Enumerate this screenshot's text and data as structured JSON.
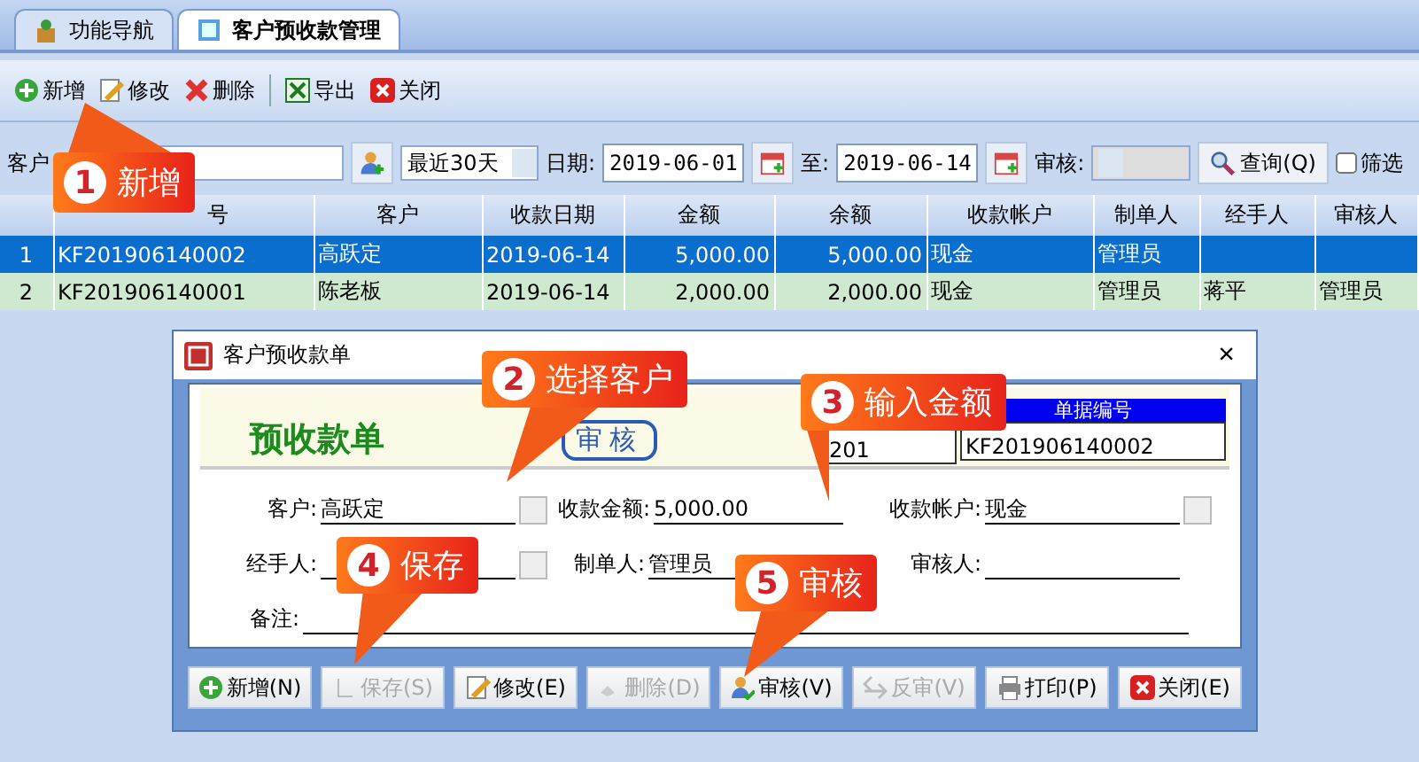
{
  "tabs": [
    {
      "label": "功能导航",
      "selected": false
    },
    {
      "label": "客户预收款管理",
      "selected": true
    }
  ],
  "toolbar": [
    {
      "label": "新增"
    },
    {
      "label": "修改"
    },
    {
      "label": "删除"
    },
    {
      "label": "导出"
    },
    {
      "label": "关闭"
    }
  ],
  "filter": {
    "customer_label": "客户",
    "period": "最近30天",
    "date_label": "日期:",
    "date_from": "2019-06-01",
    "to_label": "至:",
    "date_to": "2019-06-14",
    "audit_label": "审核:",
    "query_button": "查询(Q)",
    "checkbox": {
      "label": "筛选",
      "checked": false
    }
  },
  "table": {
    "columns": [
      "",
      "号",
      "客户",
      "收款日期",
      "金额",
      "余额",
      "收款帐户",
      "制单人",
      "经手人",
      "审核人"
    ],
    "rows": [
      {
        "selected": true,
        "cells": [
          "1",
          "KF201906140002",
          "高跃定",
          "2019-06-14",
          "5,000.00",
          "5,000.00",
          "现金",
          "管理员",
          "",
          ""
        ]
      },
      {
        "selected": false,
        "cells": [
          "2",
          "KF201906140001",
          "陈老板",
          "2019-06-14",
          "2,000.00",
          "2,000.00",
          "现金",
          "管理员",
          "蒋平",
          "管理员"
        ]
      }
    ]
  },
  "dialog": {
    "title": "客户预收款单",
    "close_button": "×",
    "heading": "预收款单",
    "stamp": "审核",
    "date": "201",
    "doc_number_label": "单据编号",
    "doc_number": "KF201906140002",
    "fields": [
      {
        "label": "客户:",
        "value": "高跃定",
        "kind": "pick"
      },
      {
        "label": "收款金额:",
        "value": "5,000.00",
        "kind": "plain"
      },
      {
        "label": "收款帐户:",
        "value": "现金",
        "kind": "pick"
      },
      {
        "label": "经手人:",
        "kind": "pick"
      },
      {
        "label": "制单人:",
        "value": "管理员",
        "kind": "plain"
      },
      {
        "label": "审核人:",
        "kind": "plain"
      },
      {
        "label": "备注:",
        "kind": "wide"
      }
    ],
    "buttons": [
      {
        "label": "新增(N)",
        "disabled": false
      },
      {
        "label": "保存(S)",
        "disabled": true
      },
      {
        "label": "修改(E)",
        "disabled": false
      },
      {
        "label": "删除(D)",
        "disabled": true
      },
      {
        "label": "审核(V)",
        "disabled": false
      },
      {
        "label": "反审(V)",
        "disabled": true
      },
      {
        "label": "打印(P)",
        "disabled": false
      },
      {
        "label": "关闭(E)",
        "disabled": false
      }
    ]
  },
  "callouts": [
    {
      "number": "1",
      "text": "新增"
    },
    {
      "number": "2",
      "text": "选择客户"
    },
    {
      "number": "3",
      "text": "输入金额"
    },
    {
      "number": "4",
      "text": "保存"
    },
    {
      "number": "5",
      "text": "审核"
    }
  ]
}
